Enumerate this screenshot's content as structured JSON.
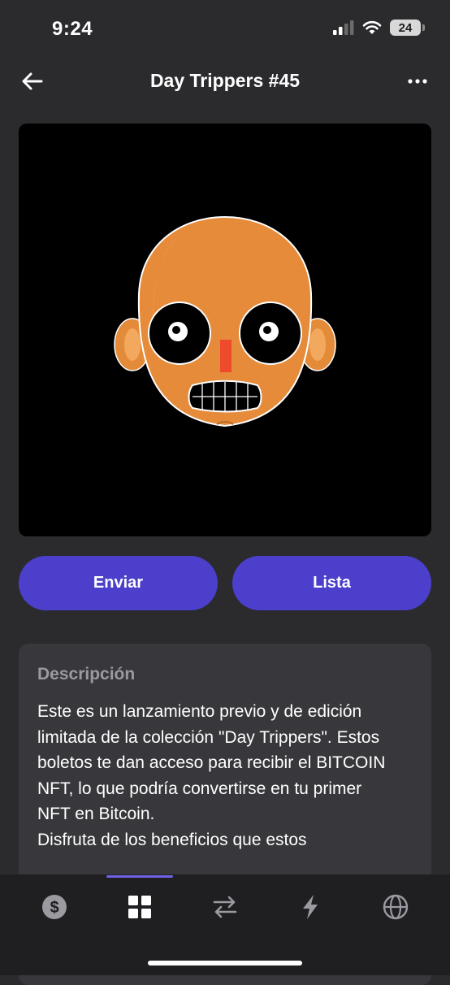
{
  "status_bar": {
    "time": "9:24",
    "battery_level": "24"
  },
  "header": {
    "title": "Day Trippers #45",
    "back_icon": "arrow-left-icon",
    "more_icon": "more-horizontal-icon"
  },
  "nft": {
    "image_label": "cartoon-bald-head"
  },
  "actions": {
    "send_label": "Enviar",
    "list_label": "Lista",
    "accent_color": "#4b3fcc"
  },
  "description": {
    "heading": "Descripción",
    "body": "Este es un lanzamiento previo y de edición limitada de la colección \"Day Trippers\". Estos boletos te dan acceso para recibir el BITCOIN NFT, lo que podría convertirse en tu primer NFT en Bitcoin.\nDisfruta de los beneficios que estos"
  },
  "tab_bar": {
    "selected": "collectibles",
    "tabs": [
      {
        "id": "wallet",
        "icon": "dollar-circle-icon"
      },
      {
        "id": "collectibles",
        "icon": "grid-icon"
      },
      {
        "id": "swap",
        "icon": "swap-arrows-icon"
      },
      {
        "id": "activity",
        "icon": "lightning-icon"
      },
      {
        "id": "browser",
        "icon": "globe-icon"
      }
    ]
  }
}
